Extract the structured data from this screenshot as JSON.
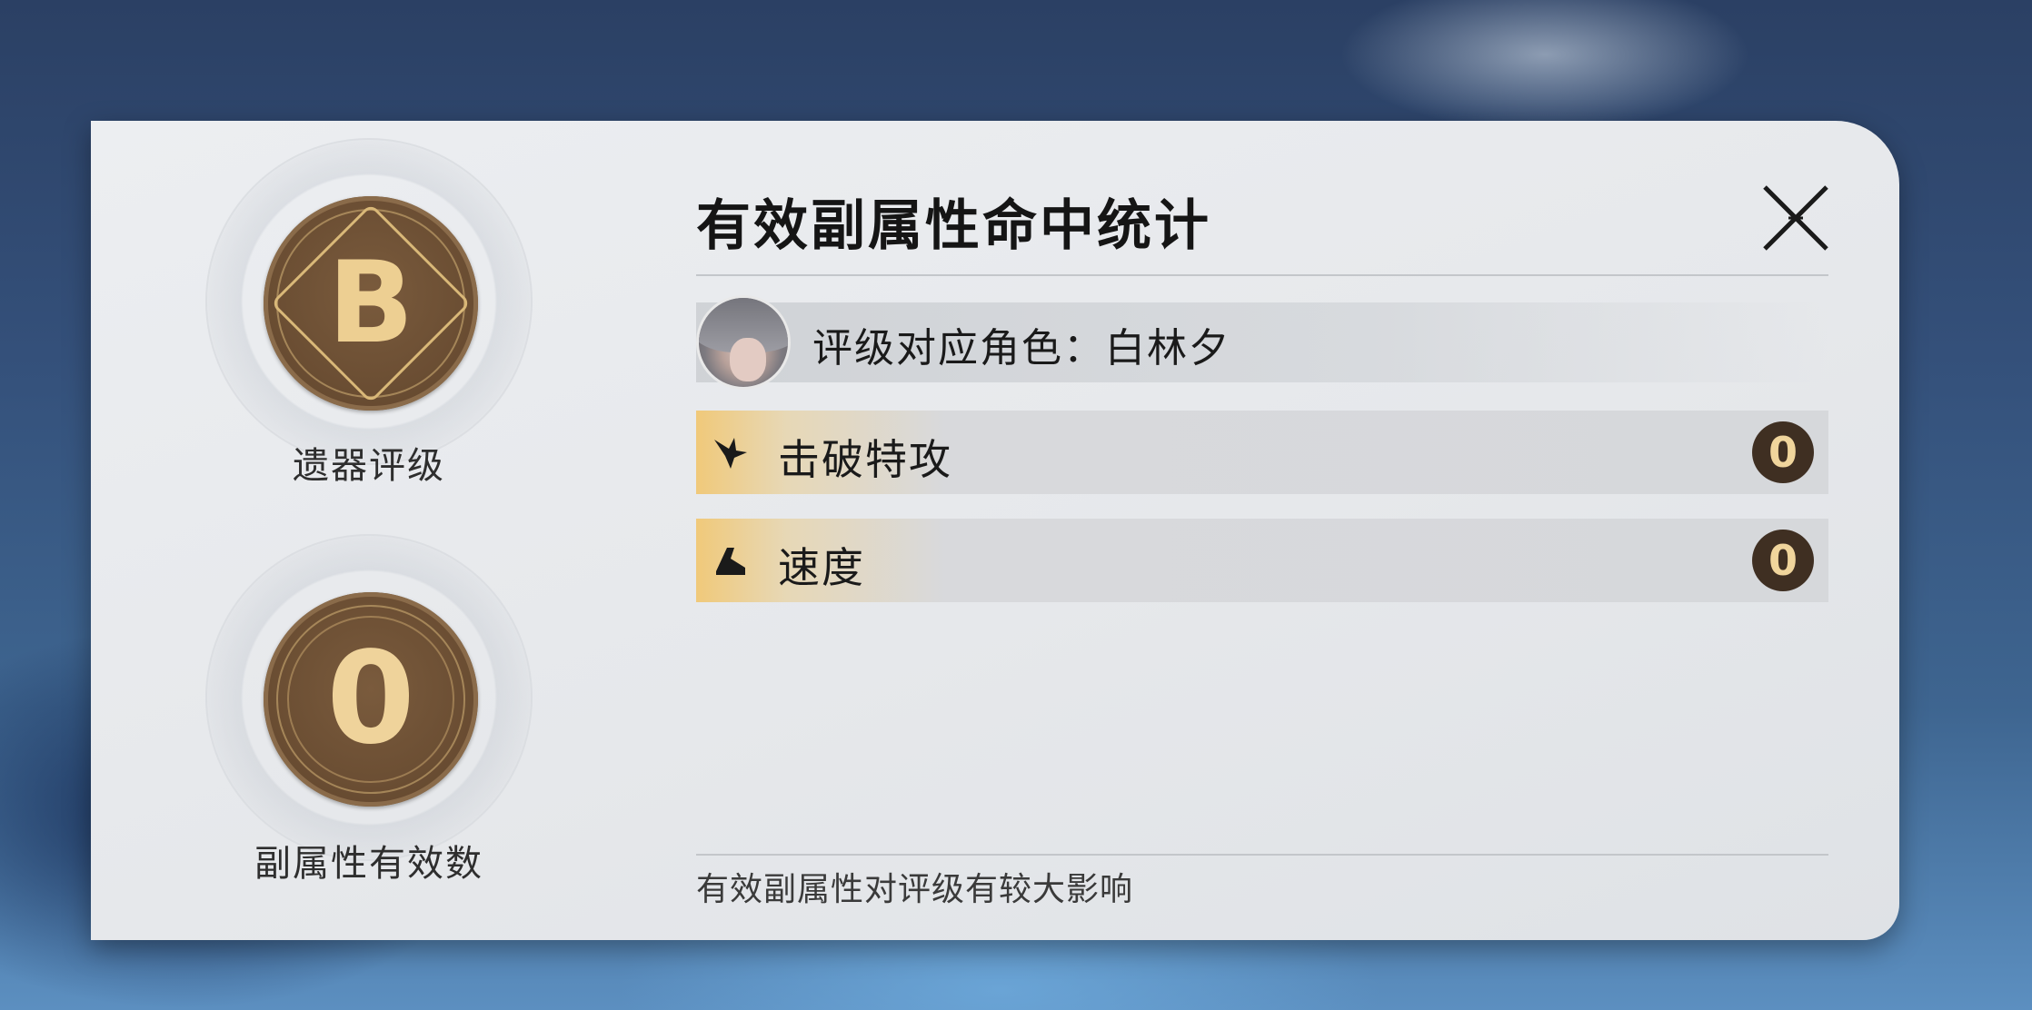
{
  "medals": {
    "relic_rating": {
      "letter": "B",
      "label": "遗器评级"
    },
    "effective_count": {
      "value": "0",
      "label": "副属性有效数"
    }
  },
  "dialog": {
    "title": "有效副属性命中统计",
    "close_icon": "close-x-icon",
    "character_label": "评级对应角色：白林夕",
    "stats": [
      {
        "icon": "break-effect-icon",
        "label": "击破特攻",
        "count": "0"
      },
      {
        "icon": "speed-icon",
        "label": "速度",
        "count": "0"
      }
    ],
    "footnote": "有效副属性对评级有较大影响"
  },
  "colors": {
    "coin_bronze": "#6b4e33",
    "coin_gold": "#edcf92",
    "stat_accent": "#f0c97a",
    "badge_dark": "#3f2f22"
  }
}
